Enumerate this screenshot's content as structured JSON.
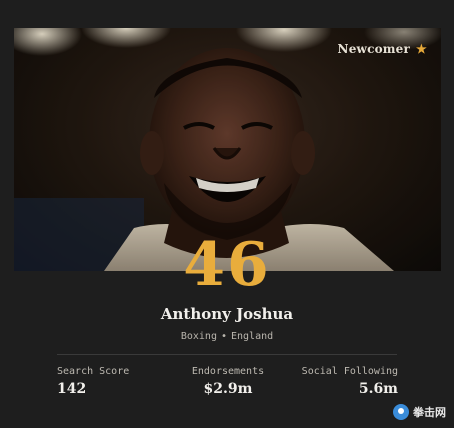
{
  "badge": {
    "label": "Newcomer",
    "icon": "star-icon",
    "icon_glyph": "★",
    "icon_color": "#e6a93a"
  },
  "rank": "46",
  "athlete": {
    "name": "Anthony Joshua",
    "sport": "Boxing",
    "separator": "•",
    "country": "England"
  },
  "stats": [
    {
      "label": "Search Score",
      "value": "142"
    },
    {
      "label": "Endorsements",
      "value": "$2.9m"
    },
    {
      "label": "Social Following",
      "value": "5.6m"
    }
  ],
  "watermark": {
    "text": "拳击网"
  },
  "colors": {
    "background": "#1e1e1e",
    "accent": "#e9ad3c",
    "text": "#f2f0ec",
    "muted": "#b9b5ad"
  }
}
